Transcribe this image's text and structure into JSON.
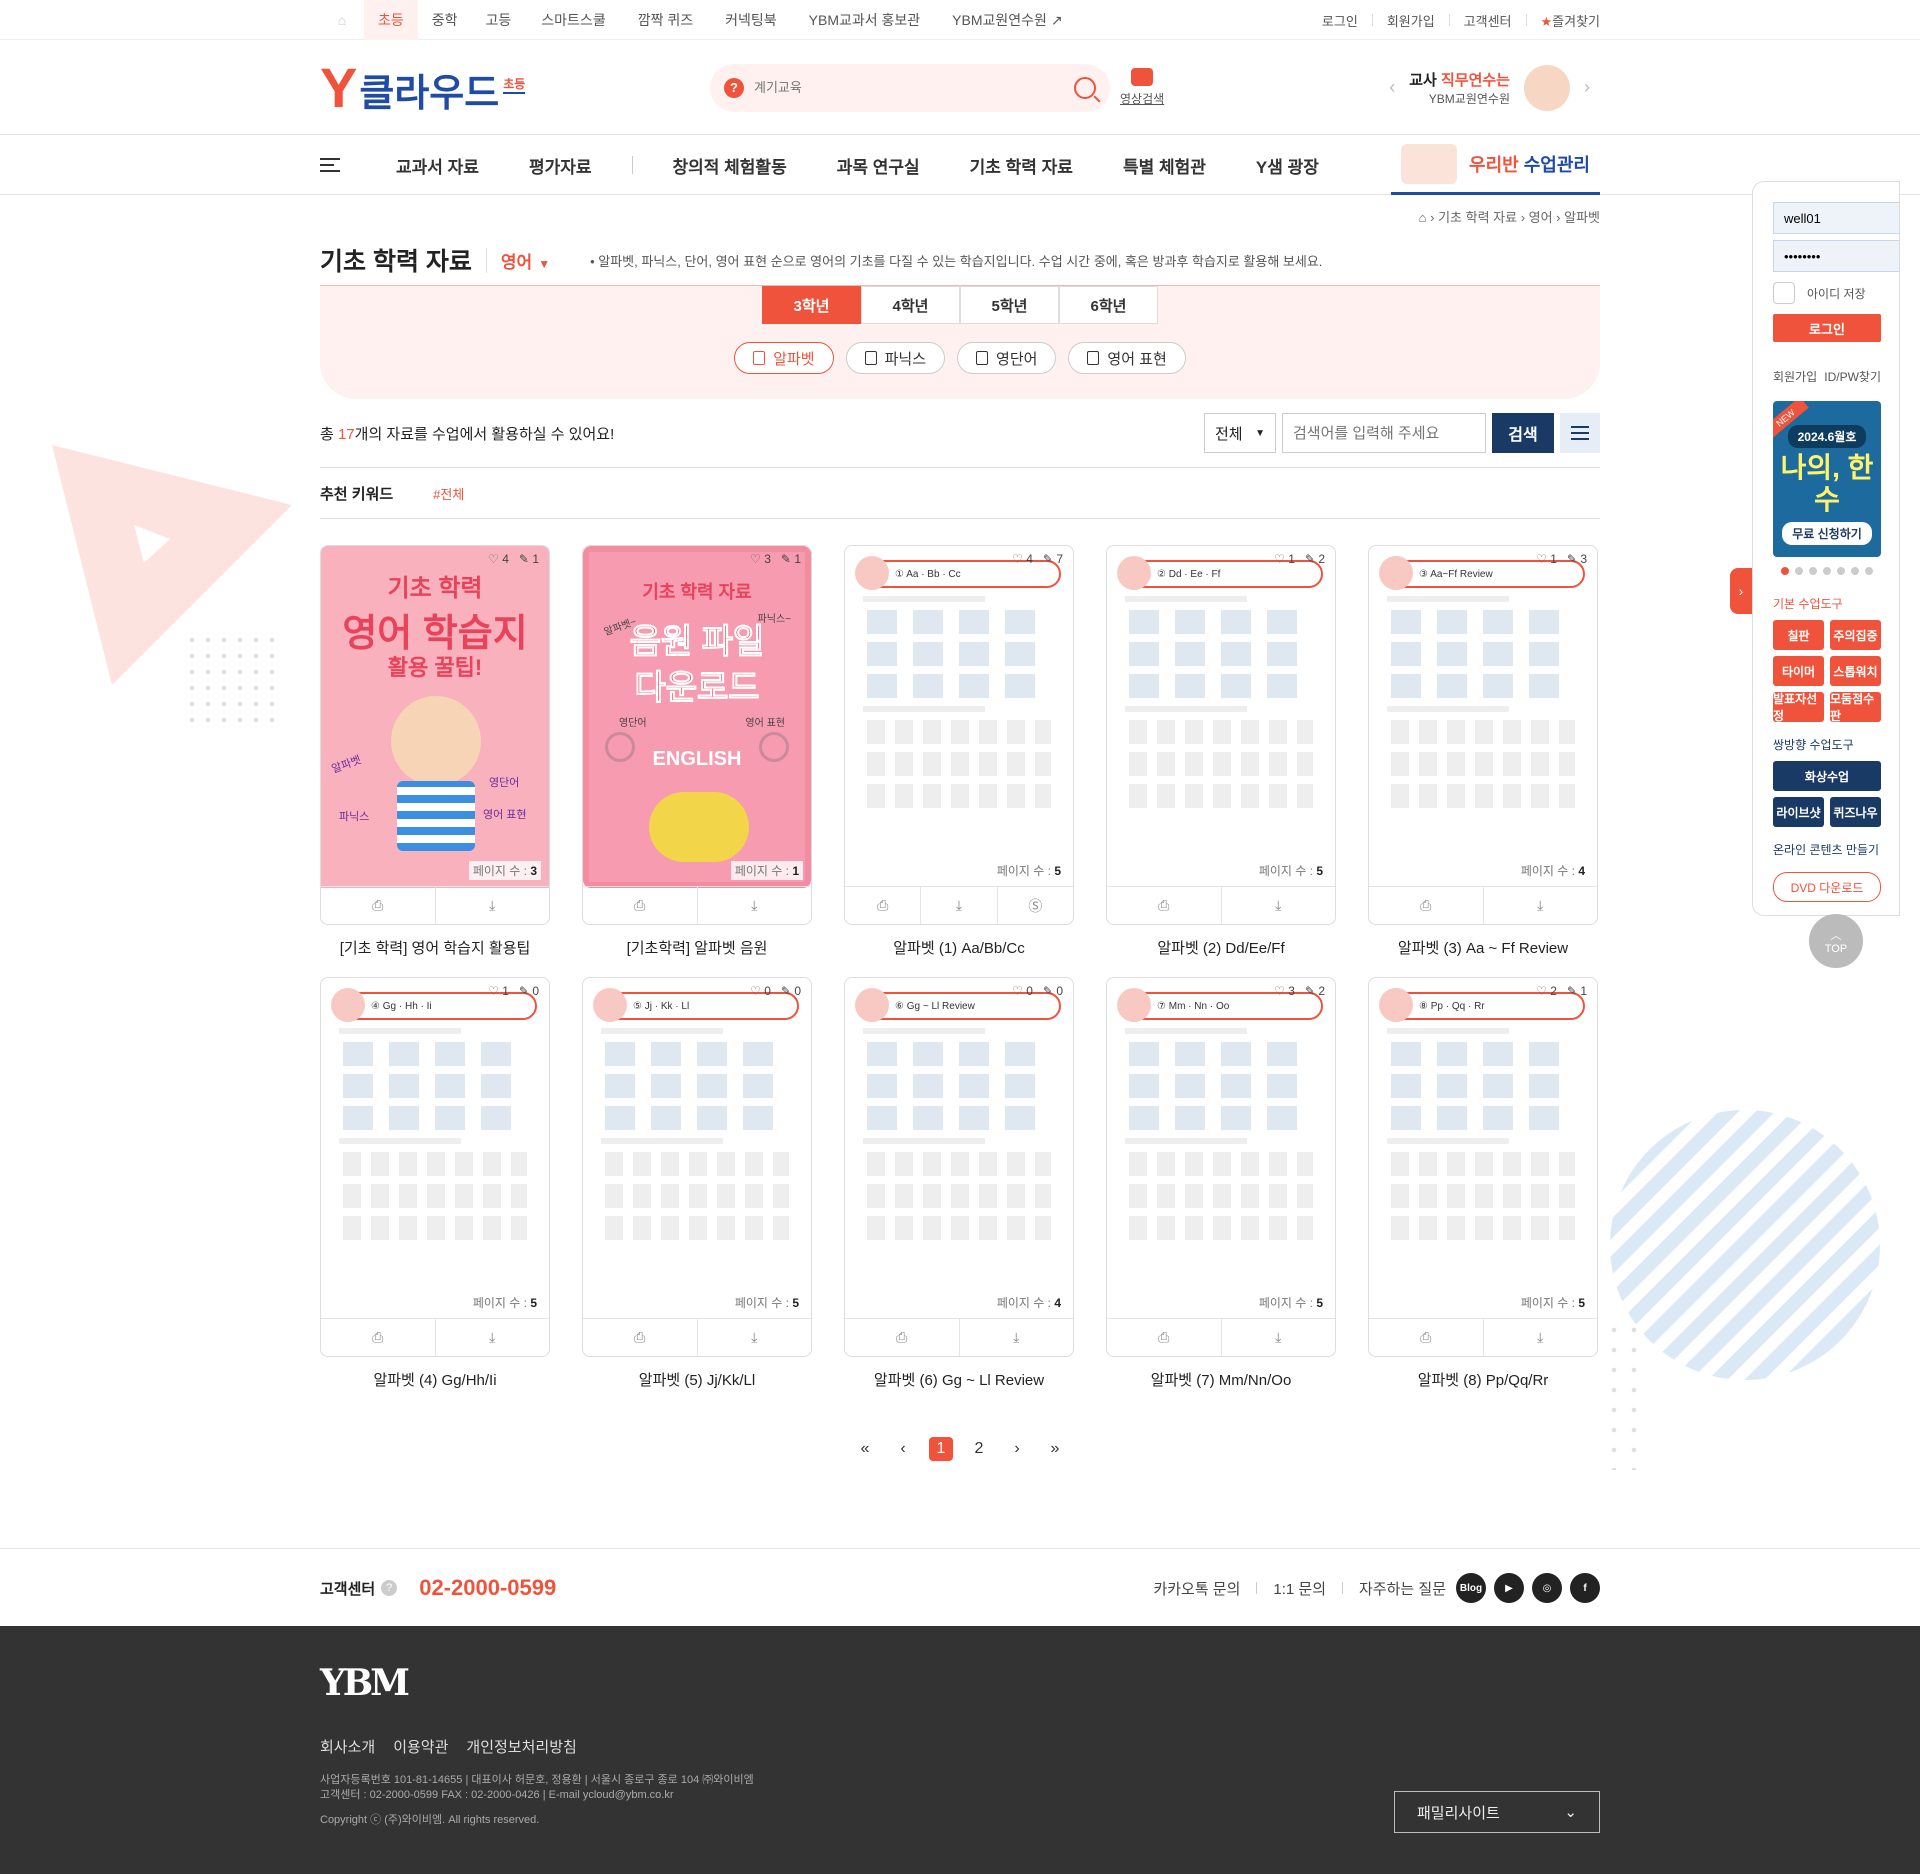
{
  "topbar": {
    "levels": [
      "초등",
      "중학",
      "고등"
    ],
    "active_level": "초등",
    "links": [
      "스마트스쿨",
      "깜짝 퀴즈",
      "커넥팅북",
      "YBM교과서 홍보관",
      "YBM교원연수원"
    ],
    "right": [
      "로그인",
      "회원가입",
      "고객센터",
      "즐겨찾기"
    ]
  },
  "header": {
    "logo_text": "클라우드",
    "logo_tag": "초등",
    "search_placeholder": "계기교육",
    "video_label": "영상검색",
    "banner_title_a": "교사 ",
    "banner_title_b": "직무연수는",
    "banner_sub": "YBM교원연수원"
  },
  "gnb": {
    "items": [
      "교과서 자료",
      "평가자료",
      "창의적 체험활동",
      "과목 연구실",
      "기초 학력 자료",
      "특별 체험관",
      "Y샘 광장"
    ],
    "myclass_a": "우리반",
    "myclass_b": "수업관리"
  },
  "breadcrumb": "› 기초 학력 자료 › 영어 › 알파벳",
  "page": {
    "title": "기초 학력 자료",
    "subject": "영어",
    "description": "• 알파벳, 파닉스, 단어, 영어 표현 순으로 영어의 기초를 다질 수 있는 학습지입니다. 수업 시간 중에, 혹은 방과후 학습지로 활용해 보세요."
  },
  "grades": [
    "3학년",
    "4학년",
    "5학년",
    "6학년"
  ],
  "active_grade": "3학년",
  "categories": [
    "알파벳",
    "파닉스",
    "영단어",
    "영어 표현"
  ],
  "active_category": "알파벳",
  "total": {
    "prefix": "총 ",
    "count": "17",
    "suffix": "개의 자료를 수업에서 활용하실 수 있어요!"
  },
  "filter": {
    "select": "전체",
    "placeholder": "검색어를 입력해 주세요",
    "button": "검색"
  },
  "keywords": {
    "label": "추천 키워드",
    "items": [
      "#전체"
    ]
  },
  "cards": [
    {
      "title": "[기초 학력] 영어 학습지 활용팁",
      "likes": "4",
      "pins": "1",
      "pages": "3",
      "kind": "cover1",
      "head": "",
      "extra": false
    },
    {
      "title": "[기초학력] 알파벳 음원",
      "likes": "3",
      "pins": "1",
      "pages": "1",
      "kind": "cover2",
      "head": "",
      "extra": false
    },
    {
      "title": "알파벳 (1) Aa/Bb/Cc",
      "likes": "4",
      "pins": "7",
      "pages": "5",
      "kind": "ws",
      "head": "① Aa · Bb · Cc",
      "extra": true
    },
    {
      "title": "알파벳 (2) Dd/Ee/Ff",
      "likes": "1",
      "pins": "2",
      "pages": "5",
      "kind": "ws",
      "head": "② Dd · Ee · Ff",
      "extra": false
    },
    {
      "title": "알파벳 (3) Aa ~ Ff Review",
      "likes": "1",
      "pins": "3",
      "pages": "4",
      "kind": "ws",
      "head": "③ Aa~Ff Review",
      "extra": false
    },
    {
      "title": "알파벳 (4) Gg/Hh/Ii",
      "likes": "1",
      "pins": "0",
      "pages": "5",
      "kind": "ws",
      "head": "④ Gg · Hh · Ii",
      "extra": false
    },
    {
      "title": "알파벳 (5) Jj/Kk/Ll",
      "likes": "0",
      "pins": "0",
      "pages": "5",
      "kind": "ws",
      "head": "⑤ Jj · Kk · Ll",
      "extra": false
    },
    {
      "title": "알파벳 (6) Gg ~ Ll Review",
      "likes": "0",
      "pins": "0",
      "pages": "4",
      "kind": "ws",
      "head": "⑥ Gg ~ Ll Review",
      "extra": false
    },
    {
      "title": "알파벳 (7) Mm/Nn/Oo",
      "likes": "3",
      "pins": "2",
      "pages": "5",
      "kind": "ws",
      "head": "⑦ Mm · Nn · Oo",
      "extra": false
    },
    {
      "title": "알파벳 (8) Pp/Qq/Rr",
      "likes": "2",
      "pins": "1",
      "pages": "5",
      "kind": "ws",
      "head": "⑧ Pp · Qq · Rr",
      "extra": false
    }
  ],
  "card_text": {
    "pages_label": "페이지 수 : ",
    "cover1_lines": [
      "기초 학력",
      "영어 학습지",
      "활용 꿀팁!"
    ],
    "cover1_tags": [
      "알파벳",
      "파닉스",
      "영단어",
      "영어 표현"
    ],
    "cover2_lines": [
      "기초 학력 자료",
      "음원 파일",
      "다운로드",
      "ENGLISH"
    ],
    "cover2_tags": [
      "알파벳~",
      "파닉스~",
      "영단어",
      "영어 표현"
    ]
  },
  "pager": {
    "pages": [
      "1",
      "2"
    ],
    "current": "1"
  },
  "cs": {
    "label": "고객센터",
    "tel": "02-2000-0599",
    "links": [
      "카카오톡 문의",
      "1:1 문의",
      "자주하는 질문"
    ],
    "blog": "Blog"
  },
  "footer": {
    "logo": "YBM",
    "links": [
      "회사소개",
      "이용약관",
      "개인정보처리방침"
    ],
    "info1": "사업자등록번호 101-81-14655 | 대표이사 허문호, 정용환 | 서울시 종로구 종로 104 ㈜와이비엠",
    "info2": "고객센터 : 02-2000-0599 FAX : 02-2000-0426 | E-mail ycloud@ybm.co.kr",
    "copyright": "Copyright ⓒ (주)와이비엠. All rights reserved.",
    "family": "패밀리사이트"
  },
  "side": {
    "id": "well01",
    "pw": "••••••••",
    "save_id": "아이디 저장",
    "login": "로그인",
    "join": "회원가입",
    "find": "ID/PW찾기",
    "promo_new": "NEW",
    "promo_issue": "2024.6월호",
    "promo_title": "나의, 한수",
    "promo_btn": "무료 신청하기",
    "tools_title": "기본 수업도구",
    "tools": [
      "칠판",
      "주의집중",
      "타이머",
      "스톱워치",
      "발표자선정",
      "모둠점수판"
    ],
    "two_way_title": "쌍방향 수업도구",
    "two_way": [
      "화상수업",
      "라이브샷",
      "퀴즈나우"
    ],
    "online_title": "온라인 콘텐츠 만들기",
    "dvd": "DVD 다운로드",
    "top": "TOP"
  }
}
